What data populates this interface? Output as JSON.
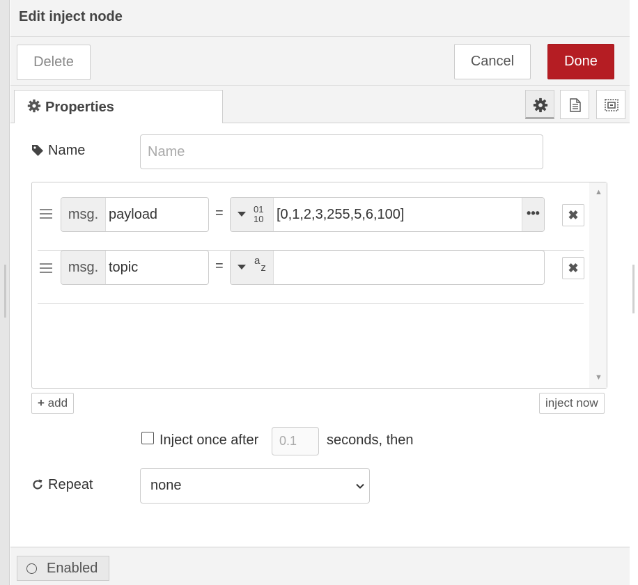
{
  "tray": {
    "title": "Edit inject node",
    "toolbar": {
      "delete_label": "Delete",
      "cancel_label": "Cancel",
      "done_label": "Done"
    },
    "tabs": [
      {
        "label": "Properties",
        "icon": "gear-icon",
        "active": true
      }
    ],
    "icon_tabs": [
      {
        "icon": "gear-icon",
        "active": true
      },
      {
        "icon": "description-icon",
        "active": false
      },
      {
        "icon": "appearance-icon",
        "active": false
      }
    ]
  },
  "form": {
    "name": {
      "label": "Name",
      "placeholder": "Name",
      "value": ""
    },
    "properties": [
      {
        "prefix": "msg.",
        "key": "payload",
        "type": "num",
        "type_top": "01",
        "type_bottom": "10",
        "value": "[0,1,2,3,255,5,6,100]",
        "has_expand": true
      },
      {
        "prefix": "msg.",
        "key": "topic",
        "type": "str",
        "type_a": "a",
        "type_z": "z",
        "value": "",
        "has_expand": false
      }
    ],
    "equals": "=",
    "add_label": "add",
    "inject_now_label": "inject now",
    "inject_once": {
      "checked": false,
      "label": "Inject once after",
      "value": "",
      "placeholder": "0.1",
      "suffix": "seconds, then"
    },
    "repeat": {
      "label": "Repeat",
      "selected": "none"
    }
  },
  "footer": {
    "enabled_label": "Enabled"
  },
  "colors": {
    "accent": "#b51d23",
    "toolbar_bg": "#f3f3f3",
    "border": "#cccccc"
  }
}
